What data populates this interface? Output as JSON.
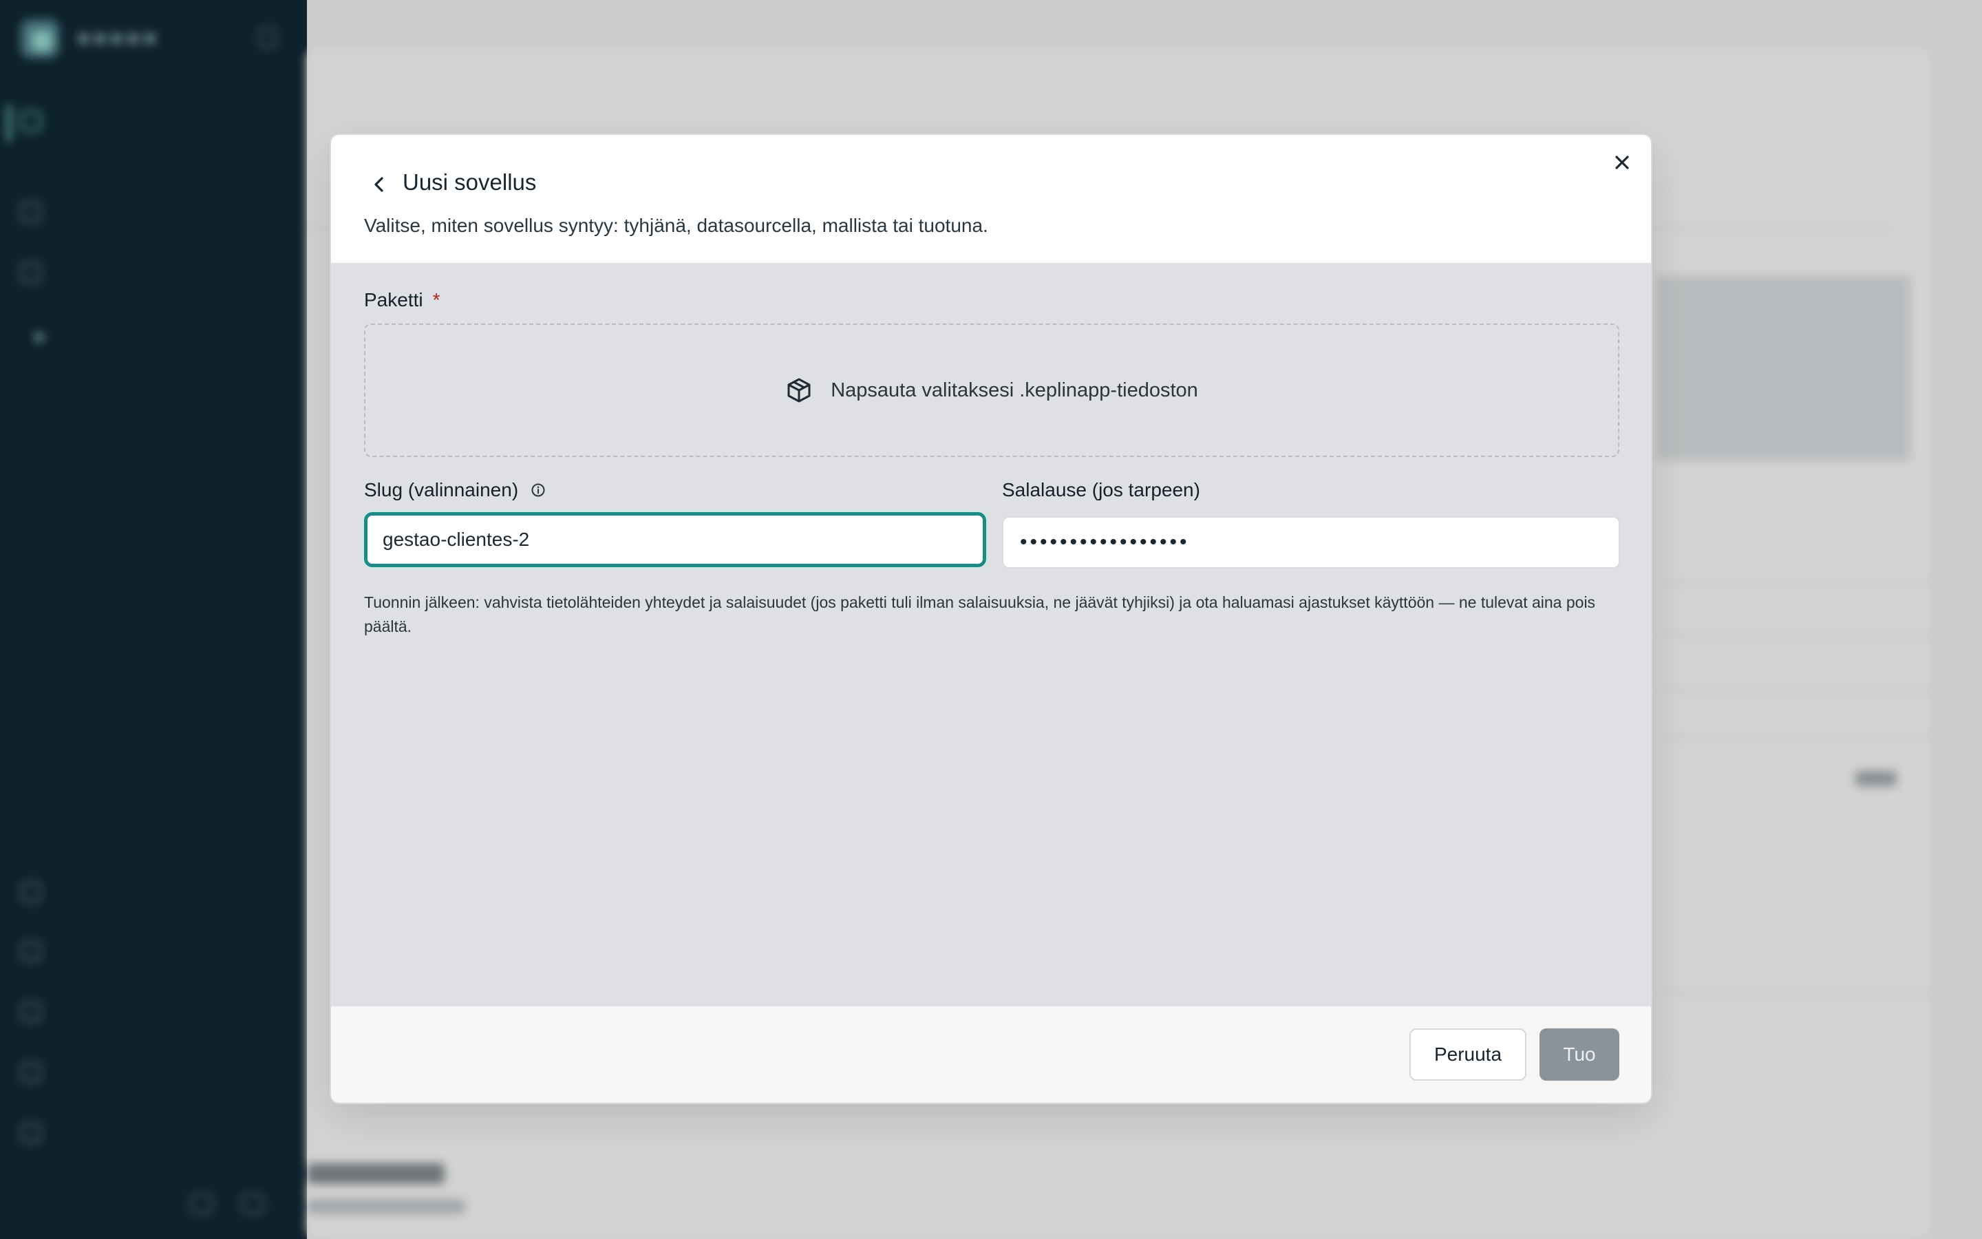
{
  "modal": {
    "title": "Uusi sovellus",
    "subtitle": "Valitse, miten sovellus syntyy: tyhjänä, datasourcella, mallista tai tuotuna.",
    "back_icon": "chevron-left-icon",
    "close_icon": "close-icon"
  },
  "package": {
    "label": "Paketti",
    "required_marker": "*",
    "dropzone_text": "Napsauta valitaksesi .keplinapp-tiedoston",
    "dropzone_icon": "package-icon"
  },
  "slug": {
    "label": "Slug (valinnainen)",
    "info_icon": "info-icon",
    "value": "gestao-clientes-2"
  },
  "passphrase": {
    "label": "Salalause (jos tarpeen)",
    "value": "•••••••••••••••••"
  },
  "help_text": "Tuonnin jälkeen: vahvista tietolähteiden yhteydet ja salaisuudet (jos paketti tuli ilman salaisuuksia, ne jäävät tyhjiksi) ja ota haluamasi ajastukset käyttöön — ne tulevat aina pois päältä.",
  "footer": {
    "cancel_label": "Peruuta",
    "import_label": "Tuo"
  },
  "colors": {
    "sidebar_bg": "#0f2631",
    "focus_ring": "#1d8a85",
    "body_bg": "#dfe0e4",
    "import_disabled": "#8a939a",
    "required": "#b3261e"
  }
}
